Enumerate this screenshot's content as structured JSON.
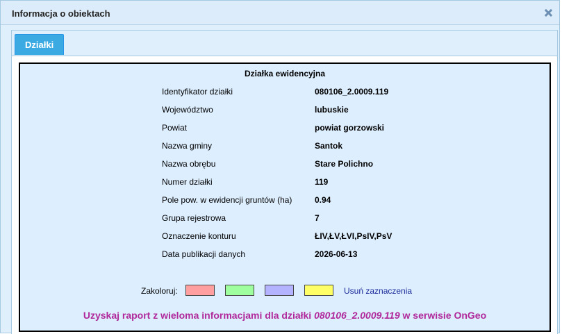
{
  "window": {
    "title": "Informacja o obiektach"
  },
  "tabs": [
    {
      "label": "Działki",
      "active": true
    }
  ],
  "section": {
    "title": "Działka ewidencyjna"
  },
  "fields": [
    {
      "label": "Identyfikator działki",
      "value": "080106_2.0009.119"
    },
    {
      "label": "Województwo",
      "value": "lubuskie"
    },
    {
      "label": "Powiat",
      "value": "powiat gorzowski"
    },
    {
      "label": "Nazwa gminy",
      "value": "Santok"
    },
    {
      "label": "Nazwa obrębu",
      "value": "Stare Polichno"
    },
    {
      "label": "Numer działki",
      "value": "119"
    },
    {
      "label": "Pole pow. w ewidencji gruntów (ha)",
      "value": "0.94"
    },
    {
      "label": "Grupa rejestrowa",
      "value": "7"
    },
    {
      "label": "Oznaczenie konturu",
      "value": "ŁIV,ŁV,ŁVI,PsIV,PsV"
    },
    {
      "label": "Data publikacji danych",
      "value": "2026-06-13"
    }
  ],
  "colorize": {
    "label": "Zakoloruj:",
    "swatches": [
      "#ff9f9f",
      "#9fff9f",
      "#b3b3ff",
      "#ffff66"
    ],
    "clear_label": "Usuń zaznaczenia"
  },
  "report": {
    "prefix": "Uzyskaj raport z wieloma informacjami dla działki ",
    "parcel_id": "080106_2.0009.119",
    "suffix": " w serwisie OnGeo"
  }
}
